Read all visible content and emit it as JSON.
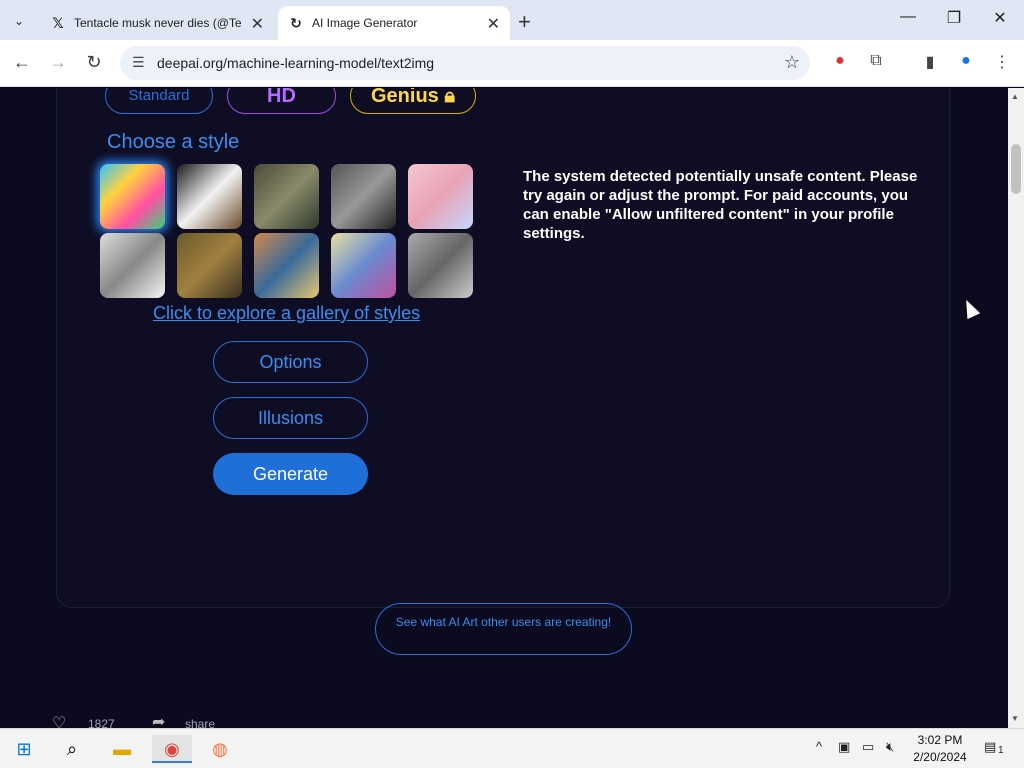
{
  "browser": {
    "tabs": [
      {
        "title": "Tentacle musk never dies (@Ten",
        "favicon": "x-logo-icon",
        "active": false
      },
      {
        "title": "AI Image Generator",
        "favicon": "deepai-icon",
        "active": true
      }
    ],
    "url": "deepai.org/machine-learning-model/text2img"
  },
  "page": {
    "quality": {
      "standard": "Standard",
      "hd": "HD",
      "genius": "Genius"
    },
    "style_heading": "Choose a style",
    "styles": [
      {
        "name": "abstract-paint",
        "colors": [
          "#2ec4ff",
          "#ffd23f",
          "#ff4fa3",
          "#34d67a"
        ]
      },
      {
        "name": "panda",
        "colors": [
          "#1a1a1a",
          "#f2f2f2",
          "#6a4a2a"
        ]
      },
      {
        "name": "forest-painting",
        "colors": [
          "#4a4a3a",
          "#8a8a6a",
          "#2e3a2e"
        ]
      },
      {
        "name": "robot",
        "colors": [
          "#555",
          "#999",
          "#222"
        ]
      },
      {
        "name": "anime-girl",
        "colors": [
          "#f4c6d0",
          "#e8a3b4",
          "#c4d7ff"
        ]
      },
      {
        "name": "sketch-car",
        "colors": [
          "#ddd",
          "#888",
          "#f5f5f5"
        ]
      },
      {
        "name": "mona-lisa",
        "colors": [
          "#6b5a2a",
          "#a08040",
          "#3a3020"
        ]
      },
      {
        "name": "flowers",
        "colors": [
          "#d08a4a",
          "#3a6a9a",
          "#e8c870"
        ]
      },
      {
        "name": "dancers",
        "colors": [
          "#e8e0a0",
          "#6a8ad0",
          "#c050a0"
        ]
      },
      {
        "name": "city-sketch",
        "colors": [
          "#aaa",
          "#666",
          "#ccc"
        ]
      }
    ],
    "gallery_link": "Click to explore a gallery of styles",
    "options_label": "Options",
    "illusions_label": "Illusions",
    "generate_label": "Generate",
    "warning": "The system detected potentially unsafe content. Please try again or adjust the prompt. For paid accounts, you can enable \"Allow unfiltered content\" in your profile settings.",
    "see_others": "See what AI Art other users are creating!",
    "likes": "1827",
    "share": "share"
  },
  "taskbar": {
    "time": "3:02 PM",
    "date": "2/20/2024",
    "notifications": "1"
  }
}
